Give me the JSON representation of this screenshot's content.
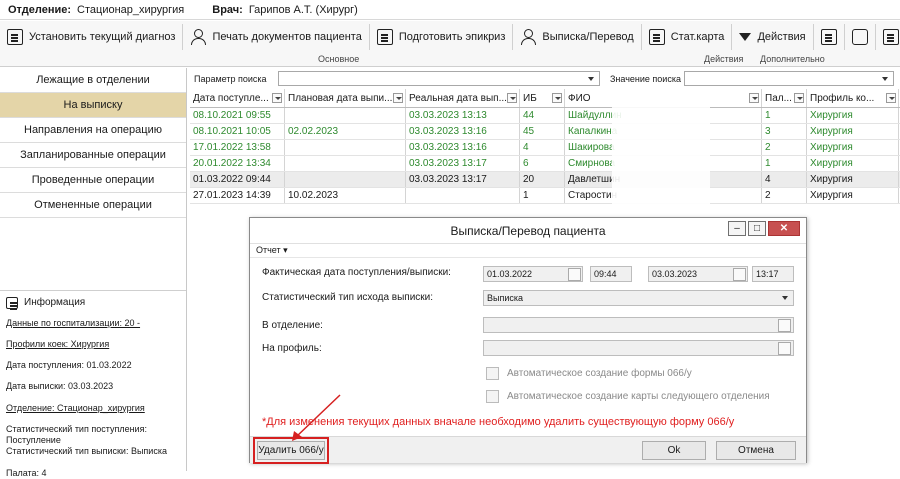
{
  "header": {
    "department_label": "Отделение:",
    "department_value": "Стационар_хирургия",
    "doctor_label": "Врач:",
    "doctor_value": "Гарипов А.Т. (Хирург)"
  },
  "toolbar": {
    "buttons": [
      {
        "label": "Установить текущий диагноз",
        "icon": "diagnosis-icon"
      },
      {
        "label": "Печать документов пациента",
        "icon": "patient-print-icon"
      },
      {
        "label": "Подготовить эпикриз",
        "icon": "epicrisis-icon"
      },
      {
        "label": "Выписка/Перевод",
        "icon": "discharge-icon"
      },
      {
        "label": "Стат.карта",
        "icon": "stat-card-icon"
      },
      {
        "label": "Действия",
        "icon": "chevron-down-icon"
      }
    ],
    "group_main": "Основное",
    "group_actions": "Действия",
    "group_extra": "Дополнительно"
  },
  "sidebar": {
    "items": [
      {
        "label": "Лежащие в отделении",
        "active": false
      },
      {
        "label": "На выписку",
        "active": true
      },
      {
        "label": "Направления на операцию",
        "active": false
      },
      {
        "label": "Запланированные операции",
        "active": false
      },
      {
        "label": "Проведенные операции",
        "active": false
      },
      {
        "label": "Отмененные операции",
        "active": false
      }
    ],
    "info": {
      "title": "Информация",
      "hosp_data": "Данные по госпитализации: 20 -",
      "bed_profiles": "Профили коек: Хирургия",
      "admission_date": "Дата поступления: 01.03.2022",
      "discharge_date": "Дата выписки: 03.03.2023",
      "department": "Отделение: Стационар_хирургия",
      "stat_admission": "Статистический тип поступления: Поступление",
      "stat_discharge": "Статистический тип выписки: Выписка",
      "ward": "Палата: 4"
    }
  },
  "search": {
    "param_label": "Параметр поиска",
    "value_label": "Значение поиска"
  },
  "grid": {
    "columns": [
      "Дата поступле...",
      "Плановая дата выпи...",
      "Реальная дата вып...",
      "ИБ",
      "ФИО",
      "Пал...",
      "Профиль ко..."
    ],
    "rows": [
      {
        "c": [
          "08.10.2021 09:55",
          "",
          "03.03.2023 13:13",
          "44",
          "Шайдуллин",
          "1",
          "Хирургия"
        ],
        "green": true,
        "selected": false
      },
      {
        "c": [
          "08.10.2021 10:05",
          "02.02.2023",
          "03.03.2023 13:16",
          "45",
          "Капалкина",
          "3",
          "Хирургия"
        ],
        "green": true,
        "selected": false
      },
      {
        "c": [
          "17.01.2022 13:58",
          "",
          "03.03.2023 13:16",
          "4",
          "Шакирова",
          "2",
          "Хирургия"
        ],
        "green": true,
        "selected": false
      },
      {
        "c": [
          "20.01.2022 13:34",
          "",
          "03.03.2023 13:17",
          "6",
          "Смирнова",
          "1",
          "Хирургия"
        ],
        "green": true,
        "selected": false
      },
      {
        "c": [
          "01.03.2022 09:44",
          "",
          "03.03.2023 13:17",
          "20",
          "Давлетшин",
          "4",
          "Хирургия"
        ],
        "green": false,
        "selected": true
      },
      {
        "c": [
          "27.01.2023 14:39",
          "10.02.2023",
          "",
          "1",
          "Старостин",
          "2",
          "Хирургия"
        ],
        "green": false,
        "selected": false
      }
    ]
  },
  "dialog": {
    "title": "Выписка/Перевод пациента",
    "menu_report": "Отчет ▾",
    "fact_date_label": "Фактическая дата поступления/выписки:",
    "admit_date": "01.03.2022",
    "admit_time": "09:44",
    "discharge_date": "03.03.2023",
    "discharge_time": "13:17",
    "stat_type_label": "Статистический тип исхода выписки:",
    "stat_type_value": "Выписка",
    "to_dept_label": "В отделение:",
    "to_profile_label": "На профиль:",
    "auto_066": "Автоматическое создание формы 066/у",
    "auto_card": "Автоматическое создание карты следующего отделения",
    "warning": "*Для изменения текущих данных вначале необходимо удалить существующую форму 066/у",
    "delete_btn": "Удалить 066/у",
    "ok_btn": "Ok",
    "cancel_btn": "Отмена"
  }
}
